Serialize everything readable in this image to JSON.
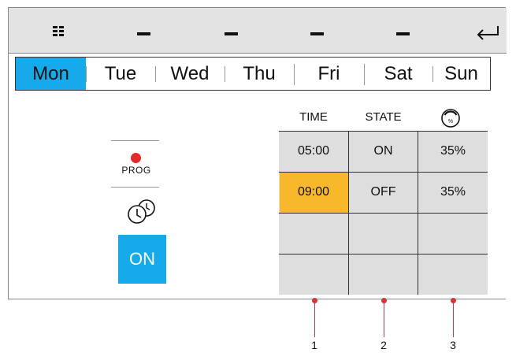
{
  "topbar": {
    "menu_icon": "grid-icon",
    "slots": [
      "–",
      "–",
      "–",
      "–"
    ],
    "back_icon": "enter-return-icon"
  },
  "days": [
    {
      "label": "Mon",
      "active": true
    },
    {
      "label": "Tue",
      "active": false
    },
    {
      "label": "Wed",
      "active": false
    },
    {
      "label": "Thu",
      "active": false
    },
    {
      "label": "Fri",
      "active": false
    },
    {
      "label": "Sat",
      "active": false
    },
    {
      "label": "Sun",
      "active": false
    }
  ],
  "controls": {
    "prog_label": "PROG",
    "prog_indicator_color": "#e32a2a",
    "timer_icon": "clock-timer-icon",
    "on_label": "ON"
  },
  "schedule": {
    "headers": {
      "time": "TIME",
      "state": "STATE",
      "level_icon": "dimmer-percent-icon"
    },
    "rows": [
      {
        "time": "05:00",
        "state": "ON",
        "level": "35%"
      },
      {
        "time": "09:00",
        "state": "OFF",
        "level": "35%",
        "selected": true
      },
      {
        "time": "",
        "state": "",
        "level": ""
      },
      {
        "time": "",
        "state": "",
        "level": ""
      }
    ]
  },
  "callouts": [
    "1",
    "2",
    "3"
  ],
  "colors": {
    "accent": "#16aaea",
    "selected": "#f7b82b",
    "callout": "#d8343a"
  }
}
